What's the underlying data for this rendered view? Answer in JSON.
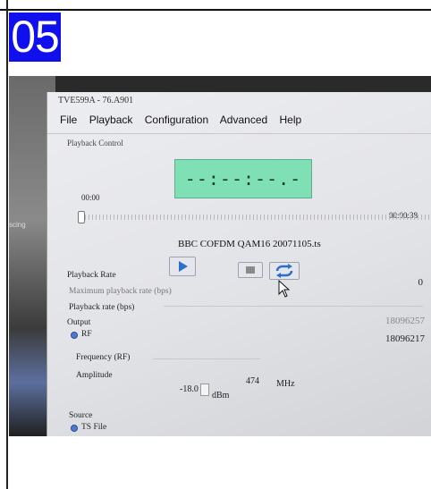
{
  "badge": {
    "number": "05",
    "color": "#1010ee"
  },
  "window": {
    "title": "TVE599A - 76.A901",
    "menu": [
      "File",
      "Playback",
      "Configuration",
      "Advanced",
      "Help"
    ]
  },
  "playback_control": {
    "group_label": "Playback Control",
    "timecode": "--:--:--.-",
    "elapsed": "00:00",
    "total": "00:00:38",
    "filename": "BBC COFDM QAM16 20071105.ts",
    "buttons": {
      "play_icon": "play-icon",
      "stop_icon": "stop-icon",
      "loop_icon": "loop-icon"
    }
  },
  "rates": {
    "playback_rate_label": "Playback Rate",
    "playback_rate_value": "0",
    "max_rate_label": "Maximum playback rate (bps)",
    "rate_label": "Playback rate (bps)",
    "rate_value_1": "18096257",
    "rate_value_2": "18096217"
  },
  "output": {
    "group_label": "Output",
    "rf_label": "RF",
    "frequency_label": "Frequency (RF)",
    "frequency_value": "474",
    "frequency_unit": "MHz",
    "amplitude_label": "Amplitude",
    "amplitude_value": "-18.0",
    "amplitude_unit": "dBm"
  },
  "source": {
    "group_label": "Source",
    "ts_file_label": "TS File"
  },
  "background": {
    "side_label": "scing"
  }
}
